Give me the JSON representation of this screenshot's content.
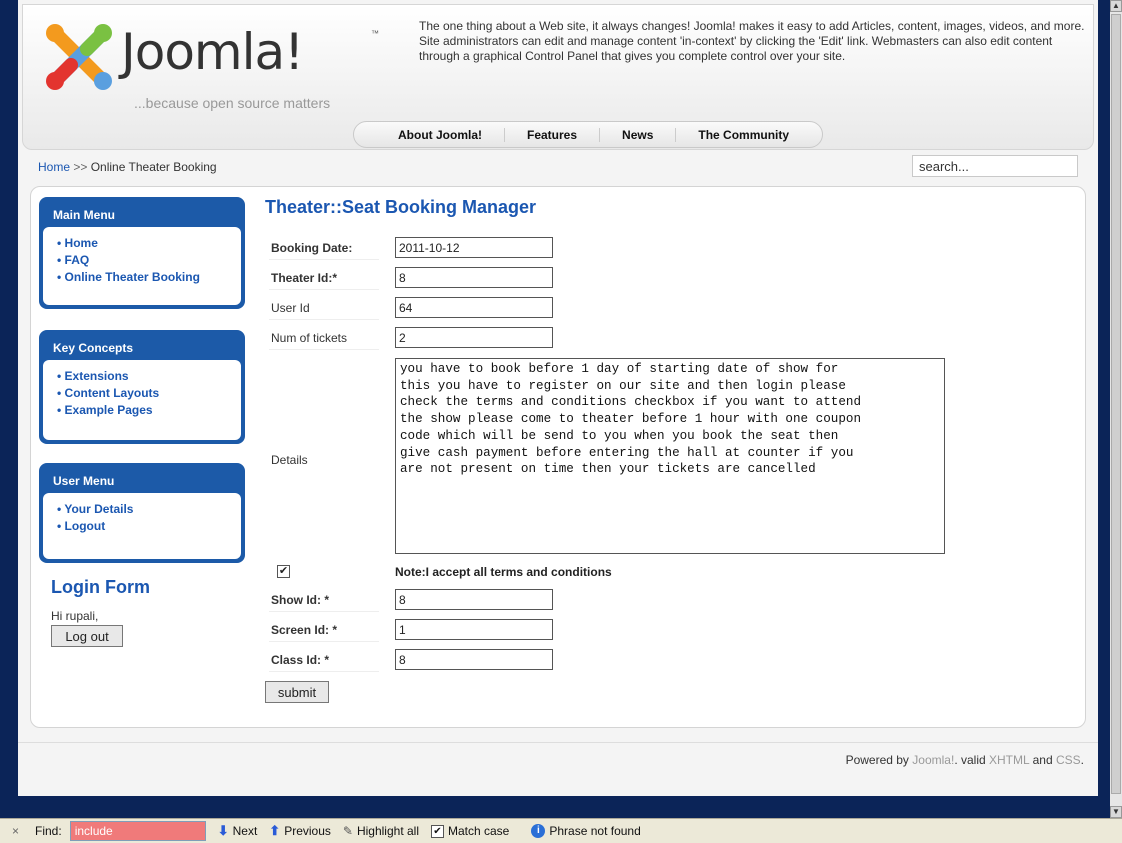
{
  "header": {
    "logo_text": "Joomla!",
    "logo_tm": "™",
    "logo_tagline": "...because open source matters",
    "intro": "The one thing about a Web site, it always changes! Joomla! makes it easy to add Articles, content, images, videos, and more. Site administrators can edit and manage content 'in-context' by clicking the 'Edit' link. Webmasters can also edit content through a graphical Control Panel that gives you complete control over your site."
  },
  "topnav": [
    "About Joomla!",
    "Features",
    "News",
    "The Community"
  ],
  "breadcrumb": {
    "home": "Home",
    "separator": ">>",
    "current": "Online Theater Booking"
  },
  "search": {
    "value": "search..."
  },
  "main_menu": {
    "title": "Main Menu",
    "items": [
      "Home",
      "FAQ",
      "Online Theater Booking"
    ]
  },
  "key_concepts": {
    "title": "Key Concepts",
    "items": [
      "Extensions",
      "Content Layouts",
      "Example Pages"
    ]
  },
  "user_menu": {
    "title": "User Menu",
    "items": [
      "Your Details",
      "Logout"
    ]
  },
  "login": {
    "title": "Login Form",
    "greeting": "Hi rupali,",
    "logout_label": "Log out"
  },
  "form": {
    "title": "Theater::Seat Booking Manager",
    "booking_date_label": "Booking Date:",
    "booking_date_value": "2011-10-12",
    "theater_id_label": "Theater Id:*",
    "theater_id_value": "8",
    "user_id_label": "User Id",
    "user_id_value": "64",
    "num_tickets_label": "Num of tickets",
    "num_tickets_value": "2",
    "details_label": "Details",
    "details_value": "you have to book before 1 day of starting date of show for\nthis you have to register on our site and then login please\ncheck the terms and conditions checkbox if you want to attend\nthe show please come to theater before 1 hour with one coupon\ncode which will be send to you when you book the seat then\ngive cash payment before entering the hall at counter if you\nare not present on time then your tickets are cancelled",
    "terms_checked": true,
    "terms_note": "Note:I accept all terms and conditions",
    "show_id_label": "Show Id: *",
    "show_id_value": "8",
    "screen_id_label": "Screen Id: *",
    "screen_id_value": "1",
    "class_id_label": "Class Id: *",
    "class_id_value": "8",
    "submit_label": "submit"
  },
  "footer": {
    "powered": "Powered by",
    "joomla": "Joomla!",
    "valid": ". valid",
    "xhtml": "XHTML",
    "and": "and",
    "css": "CSS",
    "end": "."
  },
  "findbar": {
    "close": "×",
    "label": "Find:",
    "value": "include",
    "next": "Next",
    "previous": "Previous",
    "highlight_all": "Highlight all",
    "match_case": "Match case",
    "match_case_checked": true,
    "status": "Phrase not found"
  },
  "colors": {
    "page_bg": "#0b2458",
    "accent": "#1c5aa8",
    "link": "#1b57b1",
    "find_not_found": "#f07a7a"
  }
}
